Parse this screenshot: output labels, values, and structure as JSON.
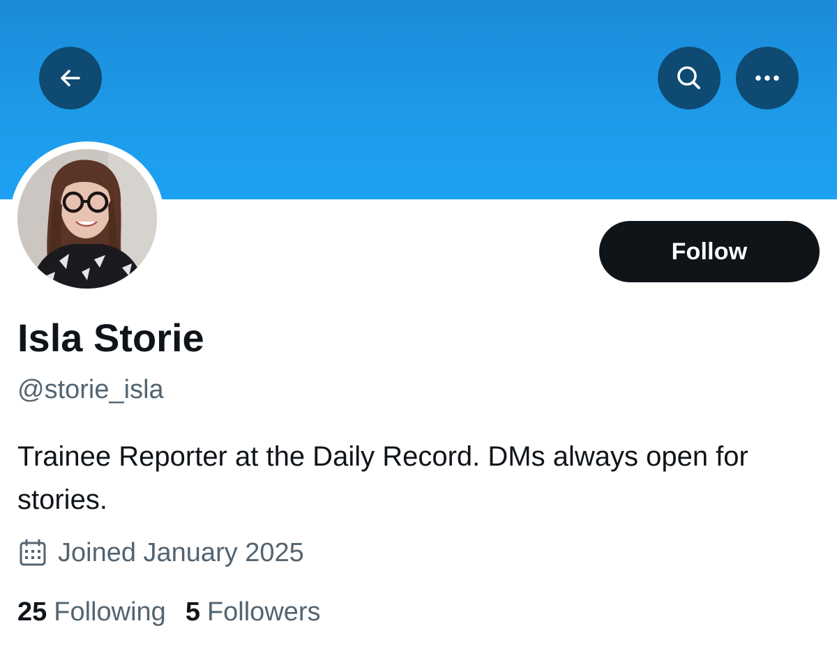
{
  "header": {
    "back_icon": "arrow-left-icon",
    "search_icon": "search-icon",
    "more_icon": "more-horizontal-icon",
    "banner_color": "#1d9ae8",
    "button_color": "#0e4a72"
  },
  "profile": {
    "display_name": "Isla Storie",
    "handle": "@storie_isla",
    "bio": "Trainee Reporter at the Daily Record. DMs always open for stories.",
    "joined": "Joined January 2025",
    "joined_icon": "calendar-icon",
    "follow_label": "Follow",
    "following_count": "25",
    "following_label": "Following",
    "followers_count": "5",
    "followers_label": "Followers"
  },
  "colors": {
    "text_primary": "#0f1419",
    "text_secondary": "#536471",
    "follow_button": "#0f1419"
  }
}
